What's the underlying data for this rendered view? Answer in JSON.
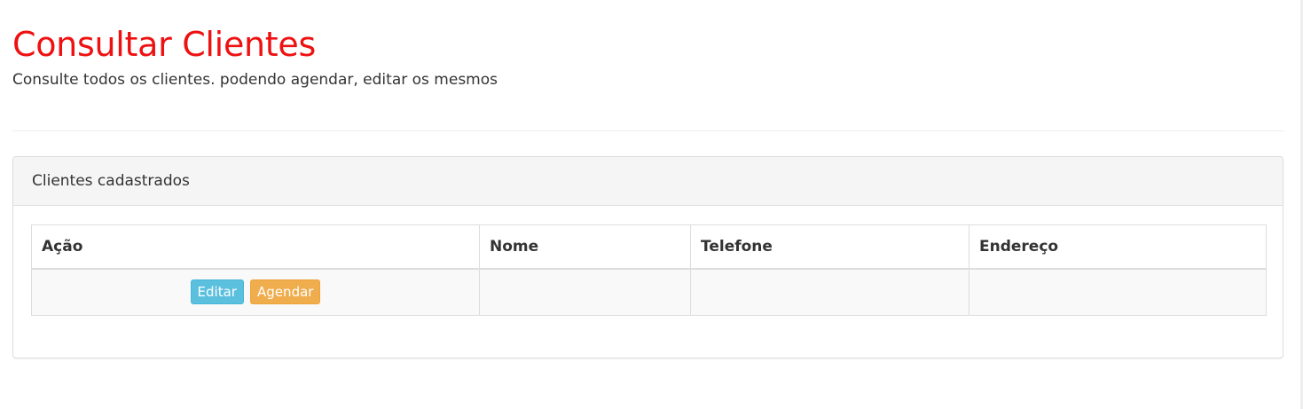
{
  "header": {
    "title": "Consultar Clientes",
    "subtitle": "Consulte todos os clientes. podendo agendar, editar os mesmos"
  },
  "panel": {
    "heading": "Clientes cadastrados",
    "table": {
      "columns": [
        "Ação",
        "Nome",
        "Telefone",
        "Endereço"
      ],
      "rows": [
        {
          "actions": {
            "edit_label": "Editar",
            "schedule_label": "Agendar"
          },
          "nome": "",
          "telefone": "",
          "endereco": ""
        }
      ]
    }
  },
  "colors": {
    "title": "#ee1111",
    "edit_button": "#5bc0de",
    "schedule_button": "#f0ad4e",
    "panel_heading_bg": "#f5f5f5",
    "row_bg": "#f9f9f9",
    "border": "#dddddd"
  }
}
